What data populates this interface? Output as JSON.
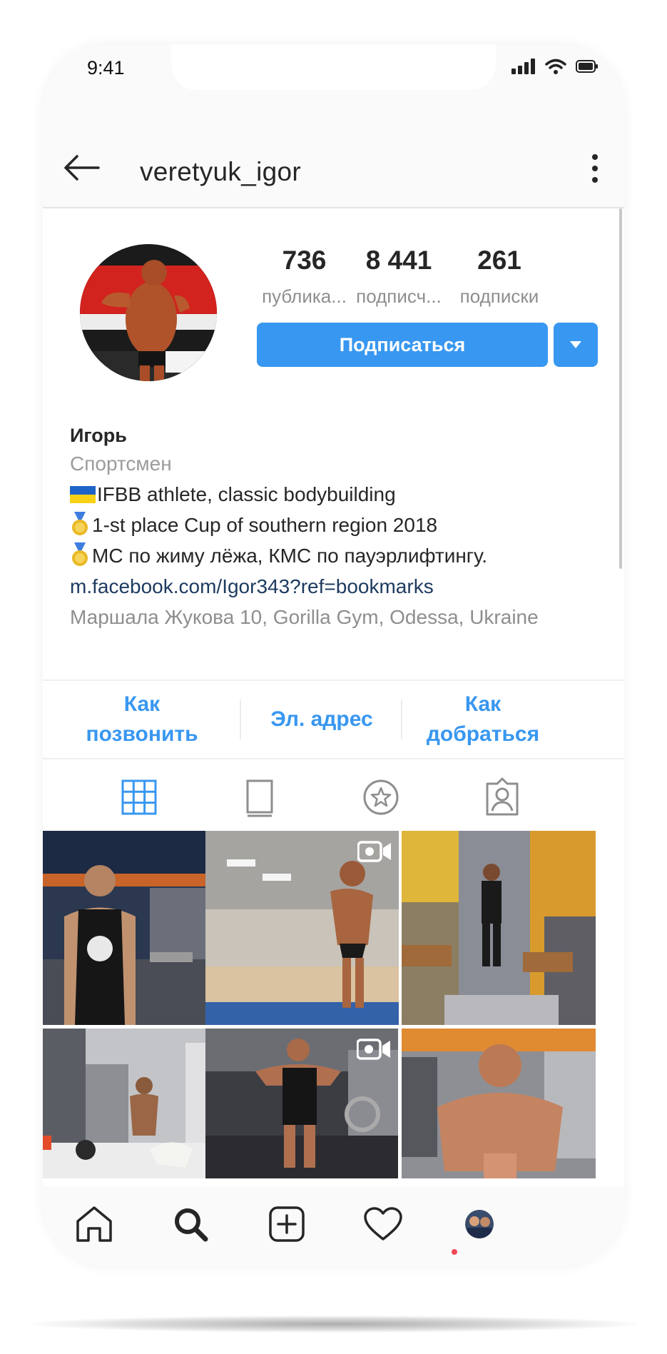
{
  "status_bar": {
    "time": "9:41"
  },
  "header": {
    "username": "veretyuk_igor"
  },
  "profile": {
    "stats": [
      {
        "value": "736",
        "label": "публика..."
      },
      {
        "value": "8 441",
        "label": "подписч..."
      },
      {
        "value": "261",
        "label": "подписки"
      }
    ],
    "follow_label": "Подписаться"
  },
  "bio": {
    "name": "Игорь",
    "category": "Спортсмен",
    "line1": "IFBB athlete, classic bodybuilding",
    "line2": "1-st place Cup of southern region 2018",
    "line3": "МС по жиму лёжа, КМС по пауэрлифтингу.",
    "link": "m.facebook.com/Igor343?ref=bookmarks",
    "address": "Маршала Жукова 10, Gorilla Gym, Odessa, Ukraine"
  },
  "contacts": {
    "call": {
      "line1": "Как",
      "line2": "позвонить"
    },
    "email": "Эл. адрес",
    "directions": {
      "line1": "Как",
      "line2": "добраться"
    }
  },
  "tabs": [
    "grid-icon",
    "igtv-icon",
    "star-icon",
    "tagged-icon"
  ],
  "grid": {
    "posts": [
      {
        "type": "carousel",
        "icon": "carousel-icon"
      },
      {
        "type": "video",
        "icon": "video-camera-icon"
      },
      {
        "type": "photo"
      },
      {
        "type": "photo"
      },
      {
        "type": "video",
        "icon": "video-camera-icon"
      },
      {
        "type": "photo"
      }
    ]
  },
  "bottom_nav": [
    "home-icon",
    "search-icon",
    "new-post-icon",
    "activity-heart-icon",
    "profile-avatar"
  ],
  "colors": {
    "accent": "#3897f0",
    "link": "#1d3a5f",
    "notification": "#ed4956"
  }
}
